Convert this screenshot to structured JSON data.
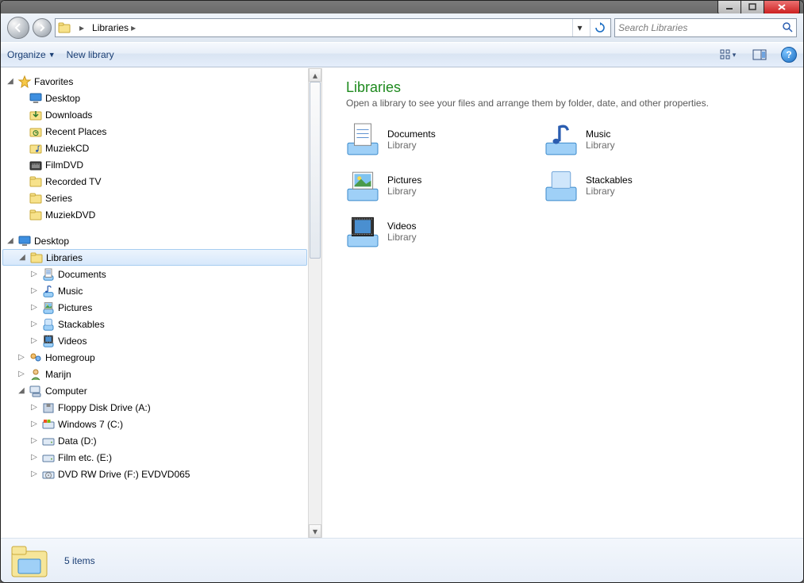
{
  "nav": {
    "breadcrumb_root": "Libraries",
    "search_placeholder": "Search Libraries"
  },
  "toolbar": {
    "organize": "Organize",
    "new_library": "New library"
  },
  "tree": {
    "favorites": "Favorites",
    "favorites_items": [
      {
        "label": "Desktop",
        "icon": "desktop"
      },
      {
        "label": "Downloads",
        "icon": "downloads"
      },
      {
        "label": "Recent Places",
        "icon": "recent"
      },
      {
        "label": "MuziekCD",
        "icon": "folder-music"
      },
      {
        "label": "FilmDVD",
        "icon": "folder-film"
      },
      {
        "label": "Recorded TV",
        "icon": "folder"
      },
      {
        "label": "Series",
        "icon": "folder"
      },
      {
        "label": "MuziekDVD",
        "icon": "folder"
      }
    ],
    "desktop": "Desktop",
    "libraries": "Libraries",
    "library_children": [
      {
        "label": "Documents",
        "icon": "lib-doc"
      },
      {
        "label": "Music",
        "icon": "lib-music"
      },
      {
        "label": "Pictures",
        "icon": "lib-pic"
      },
      {
        "label": "Stackables",
        "icon": "lib-generic"
      },
      {
        "label": "Videos",
        "icon": "lib-vid"
      }
    ],
    "homegroup": "Homegroup",
    "user": "Marijn",
    "computer": "Computer",
    "drives": [
      {
        "label": "Floppy Disk Drive (A:)",
        "icon": "floppy"
      },
      {
        "label": "Windows 7 (C:)",
        "icon": "drive-win"
      },
      {
        "label": "Data (D:)",
        "icon": "drive"
      },
      {
        "label": "Film etc. (E:)",
        "icon": "drive"
      },
      {
        "label": "DVD RW Drive (F:) EVDVD065",
        "icon": "optical"
      }
    ]
  },
  "content": {
    "title": "Libraries",
    "subtitle": "Open a library to see your files and arrange them by folder, date, and other properties.",
    "items": [
      {
        "name": "Documents",
        "type": "Library",
        "icon": "lib-doc"
      },
      {
        "name": "Music",
        "type": "Library",
        "icon": "lib-music"
      },
      {
        "name": "Pictures",
        "type": "Library",
        "icon": "lib-pic"
      },
      {
        "name": "Stackables",
        "type": "Library",
        "icon": "lib-generic"
      },
      {
        "name": "Videos",
        "type": "Library",
        "icon": "lib-vid"
      }
    ]
  },
  "status": {
    "item_count": "5 items"
  }
}
